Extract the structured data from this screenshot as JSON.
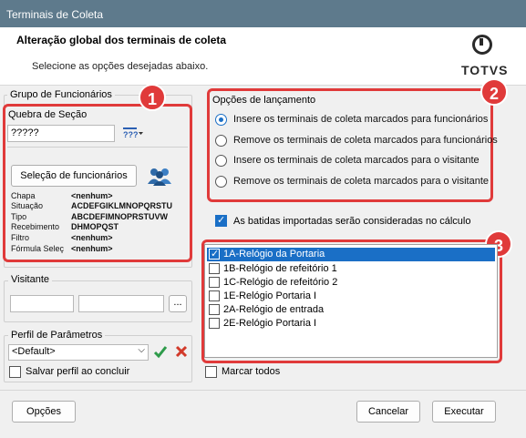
{
  "window": {
    "title": "Terminais de Coleta"
  },
  "header": {
    "title": "Alteração global dos terminais de coleta",
    "subtitle": "Selecione as opções desejadas abaixo.",
    "logo_text": "TOTVS"
  },
  "grupo": {
    "title": "Grupo de Funcionários",
    "quebra_label": "Quebra de Seção",
    "quebra_value": "?????",
    "selecao_button": "Seleção de funcionários",
    "info": [
      {
        "label": "Chapa",
        "value": "<nenhum>"
      },
      {
        "label": "Situação",
        "value": "ACDEFGIKLMNOPQRSTU"
      },
      {
        "label": "Tipo",
        "value": "ABCDEFIMNOPRSTUVW"
      },
      {
        "label": "Recebimento",
        "value": "DHMOPQST"
      },
      {
        "label": "Filtro",
        "value": "<nenhum>"
      },
      {
        "label": "Fórmula Seleç",
        "value": "<nenhum>"
      }
    ]
  },
  "visitante": {
    "title": "Visitante",
    "browse_button": "..."
  },
  "perfil": {
    "title": "Perfil de Parâmetros",
    "selected": "<Default>",
    "save_label": "Salvar perfil ao concluir"
  },
  "opcoes_lancamento": {
    "title": "Opções de lançamento",
    "options": [
      "Insere os terminais de coleta marcados para funcionários",
      "Remove os terminais de coleta marcados para funcionários",
      "Insere os terminais de coleta marcados para o visitante",
      "Remove os terminais de coleta marcados para o visitante"
    ],
    "selected_index": 0
  },
  "batidas_label": "As batidas importadas serão consideradas no cálculo",
  "terminais": [
    {
      "label": "1A-Relógio da Portaria",
      "checked": true,
      "selected": true
    },
    {
      "label": "1B-Relógio de refeitório 1",
      "checked": false
    },
    {
      "label": "1C-Relógio de refeitório 2",
      "checked": false
    },
    {
      "label": "1E-Relógio Portaria I",
      "checked": false
    },
    {
      "label": "2A-Relógio de entrada",
      "checked": false
    },
    {
      "label": "2E-Relógio Portaria I",
      "checked": false
    }
  ],
  "marcar_todos": "Marcar todos",
  "badges": [
    "1",
    "2",
    "3"
  ],
  "buttons": {
    "opcoes": "Opções",
    "cancelar": "Cancelar",
    "executar": "Executar"
  },
  "colors": {
    "accent": "#1a6fc6",
    "highlight": "#e03a3a",
    "titlebar": "#5e7a8c"
  }
}
